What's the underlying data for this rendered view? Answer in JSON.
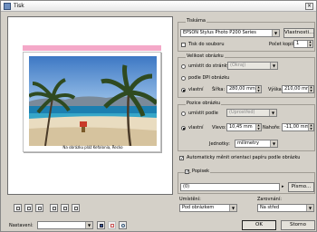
{
  "window": {
    "title": "Tisk",
    "close_glyph": "×"
  },
  "preview": {
    "caption": "Na obrázku pláž Kefalonia, Řecko"
  },
  "printer": {
    "group_label": "Tiskárna",
    "name": "EPSON Stylus Photo P200 Series",
    "props_button": "Vlastnosti...",
    "print_to_file_label": "Tisk do souboru",
    "copies_label": "Počet kopií:",
    "copies_value": "1"
  },
  "image_size": {
    "group_label": "Velikost obrázku",
    "fit_page_label": "umístit do stránky",
    "fit_page_value": "(Okraj)",
    "by_dpi_label": "podle DPI obrázku",
    "custom_label": "vlastní",
    "width_label": "Šířka:",
    "width_value": "280,00 mm",
    "height_label": "Výška:",
    "height_value": "210,00 mm"
  },
  "position": {
    "group_label": "Pozice obrázku",
    "center_label": "umístit podle",
    "center_value": "(Uprostřed)",
    "custom_label": "vlastní",
    "left_label": "Vlevo:",
    "left_value": "10,45 mm",
    "top_label": "Nahoře:",
    "top_value": "-11,00 mm",
    "units_label": "Jednotky:",
    "units_value": "milimetry"
  },
  "auto_rotate_label": "Automaticky měnit orientaci papíru podle obrázku",
  "caption_group": {
    "label": "Popisek",
    "value": "(0)",
    "font_button": "Písmo..."
  },
  "placement": {
    "label": "Umístění:",
    "value": "Pod obrázkem"
  },
  "alignment": {
    "label": "Zarovnání:",
    "value": "Na střed"
  },
  "bottom": {
    "preset_label": "Nastavení:",
    "preset_value": "",
    "ok": "OK",
    "cancel": "Storno"
  },
  "colors": {
    "margin": "#f4a8c8",
    "face": "#d4d0c8"
  }
}
